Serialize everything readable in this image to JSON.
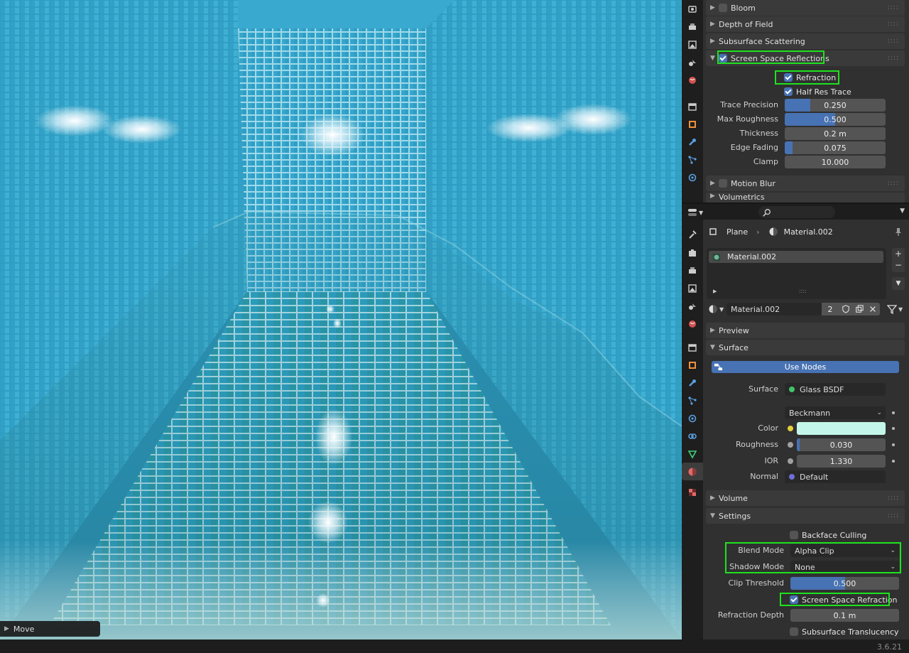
{
  "viewport": {
    "operator_panel": "Move"
  },
  "render_panel": {
    "sections": [
      {
        "label": "Bloom",
        "checked": false
      },
      {
        "label": "Depth of Field"
      },
      {
        "label": "Subsurface Scattering"
      },
      {
        "label": "Screen Space Reflections",
        "checked": true
      },
      {
        "label": "Motion Blur",
        "checked": false
      },
      {
        "label": "Volumetrics"
      }
    ],
    "ssr": {
      "refraction": "Refraction",
      "half_res": "Half Res Trace",
      "props": [
        {
          "label": "Trace Precision",
          "value": "0.250",
          "fraction": 0.25
        },
        {
          "label": "Max Roughness",
          "value": "0.500",
          "fraction": 0.5
        },
        {
          "label": "Thickness",
          "value": "0.2 m",
          "fraction": 0
        },
        {
          "label": "Edge Fading",
          "value": "0.075",
          "fraction": 0.075
        },
        {
          "label": "Clamp",
          "value": "10.000",
          "fraction": 0
        }
      ]
    }
  },
  "material_panel": {
    "breadcrumb": {
      "object": "Plane",
      "material": "Material.002"
    },
    "slot": "Material.002",
    "datablock": {
      "name": "Material.002",
      "users": "2"
    },
    "sections": {
      "preview": "Preview",
      "surface": "Surface",
      "volume": "Volume",
      "settings": "Settings"
    },
    "use_nodes": "Use Nodes",
    "surface": {
      "surface_label": "Surface",
      "surface_value": "Glass BSDF",
      "distribution": "Beckmann",
      "color_label": "Color",
      "color_value": "#c4f7e9",
      "roughness_label": "Roughness",
      "roughness_value": "0.030",
      "roughness_fraction": 0.03,
      "ior_label": "IOR",
      "ior_value": "1.330",
      "normal_label": "Normal",
      "normal_value": "Default"
    },
    "settings": {
      "backface": "Backface Culling",
      "blend_label": "Blend Mode",
      "blend_value": "Alpha Clip",
      "shadow_label": "Shadow Mode",
      "shadow_value": "None",
      "clip_label": "Clip Threshold",
      "clip_value": "0.500",
      "clip_fraction": 0.5,
      "ssr_refraction": "Screen Space Refraction",
      "refraction_depth_label": "Refraction Depth",
      "refraction_depth_value": "0.1 m",
      "sss_translucency": "Subsurface Translucency"
    }
  },
  "status_bar": {
    "version": "3.6.21"
  },
  "colors": {
    "accent": "#4772b3",
    "highlight": "#1ee21e",
    "panel": "#303030"
  }
}
